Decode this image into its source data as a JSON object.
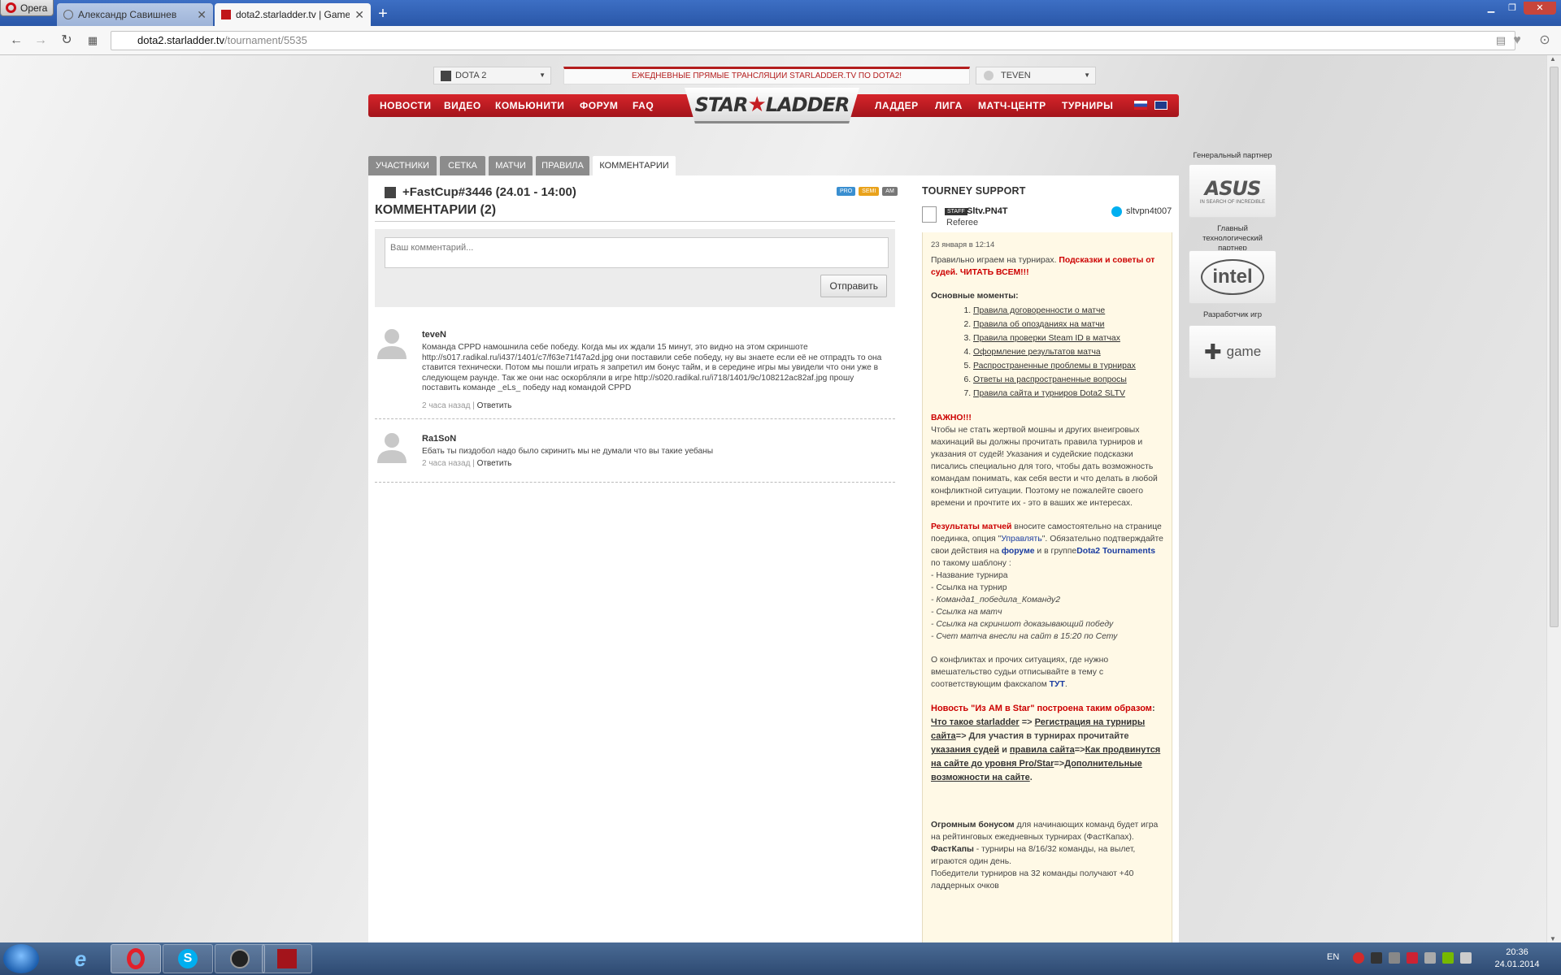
{
  "browser": {
    "menu_label": "Opera",
    "tabs": [
      {
        "label": "Александр Савишнев",
        "active": false
      },
      {
        "label": "dota2.starladder.tv | Game",
        "active": true
      }
    ],
    "new_tab": "+",
    "url_host": "dota2.starladder.tv",
    "url_path": "/tournament/5535"
  },
  "topbar": {
    "game_select": "DOTA 2",
    "promo": "ЕЖЕДНЕВНЫЕ ПРЯМЫЕ ТРАНСЛЯЦИИ STARLADDER.TV ПО DOTA2!",
    "user_select": "TEVEN"
  },
  "nav": {
    "left": [
      "НОВОСТИ",
      "ВИДЕО",
      "КОМЬЮНИТИ",
      "ФОРУМ",
      "FAQ"
    ],
    "logo_left": "STAR",
    "logo_right": "LADDER",
    "right": [
      "ЛАДДЕР",
      "ЛИГА",
      "МАТЧ-ЦЕНТР",
      "ТУРНИРЫ"
    ]
  },
  "page_tabs": [
    "УЧАСТНИКИ",
    "СЕТКА",
    "МАТЧИ",
    "ПРАВИЛА",
    "КОММЕНТАРИИ"
  ],
  "tournament": {
    "title": "+FastCup#3446 (24.01 - 14:00)",
    "badges": [
      {
        "label": "PRO",
        "color": "#3a8fd0"
      },
      {
        "label": "SEMI",
        "color": "#e9a21b"
      },
      {
        "label": "AM",
        "color": "#777777"
      }
    ]
  },
  "comments": {
    "heading": "КОММЕНТАРИИ (2)",
    "placeholder": "Ваш комментарий...",
    "submit": "Отправить",
    "reply_label": "Ответить",
    "items": [
      {
        "author": "teveN",
        "text": "Команда CPPD намошнила себе победу. Когда мы их ждали 15 минут, это видно на этом скриншоте http://s017.radikal.ru/i437/1401/c7/f63e71f47a2d.jpg они поставили себе победу, ну вы знаете если её не отпрадть то она ставится технически. Потом мы пошли играть я запретил им бонус тайм, и в середине игры мы увидели что они уже в следующем раунде. Так же они нас оскорбляли в игре http://s020.radikal.ru/i718/1401/9c/108212ac82af.jpg прошу поставить команде _eLs_ победу над командой CPPD",
        "time": "2 часа назад"
      },
      {
        "author": "Ra1SoN",
        "text": "Ебать ты пиздобол надо было скринить мы не думали что вы такие уебаны",
        "time": "2 часа назад"
      }
    ]
  },
  "support": {
    "title": "TOURNEY SUPPORT",
    "staff_tag": "STAFF",
    "referee_name": "Sltv.PN4T",
    "referee_role": "Referee",
    "skype": "sltvpn4t007",
    "date": "23 января в 12:14",
    "intro": "Правильно играем на турнирах.",
    "intro_red": "Подсказки и советы от судей. ЧИТАТЬ ВСЕМ!!!",
    "points_heading": "Основные моменты:",
    "points": [
      "Правила договоренности о матче",
      "Правила об опозданиях на матчи",
      "Правила проверки Steam ID в матчах",
      "Оформление результатов матча",
      "Распространенные проблемы в турнирах",
      "Ответы на распространенные вопросы",
      "Правила сайта и турниров Dota2 SLTV"
    ],
    "important_heading": "ВАЖНО!!!",
    "important_text": "Чтобы не стать жертвой мошны и других внеигровых махинаций вы должны прочитать правила турниров и указания от судей! Указания и судейские подсказки писались специально для того, чтобы дать возможность командам понимать, как себя вести и что делать в любой конфликтной ситуации. Поэтому не пожалейте своего времени и прочтите их - это в ваших же интересах.",
    "results_red": "Результаты матчей",
    "results_1": " вносите самостоятельно на странице поединка, опция \"",
    "results_manage": "Управлять",
    "results_2": "\". Обязательно подтверждайте свои действия на ",
    "results_forum": "форуме",
    "results_3": " и в группе",
    "results_group": "Dota2 Tournaments",
    "results_4": " по такому шаблону :",
    "template_lines": [
      "- Название турнира",
      "- Ссылка на турнир",
      "- Команда1_победила_Команду2",
      "- Ссылка на матч",
      "- Ссылка на скриншот доказывающий победу",
      "- Счет матча внесли на сайт в 15:20 по Сету"
    ],
    "conflicts_1": "О конфликтах и прочих ситуациях, где нужно вмешательство судьи отписывайте в тему с соответствующим факскапом ",
    "conflicts_link": "ТУТ",
    "conflicts_2": ".",
    "news_red": "Новость \"Из АМ в Star\" построена таким образом",
    "news_links": [
      "Что такое starladder",
      "Регистрация на турниры сайта",
      "указания судей",
      "правила сайта",
      "Как продвинутся на сайте до уровня Pro/Star",
      "Дополнительные возможности на сайте"
    ],
    "news_mid": "=> Для участия в турнирах прочитайте ",
    "bonus_bold": "Огромным бонусом",
    "bonus_text": " для начинающих команд будет игра на рейтинговых ежедневных турнирах (ФастКапах).",
    "fastcup_bold": "ФастКапы",
    "fastcup_text": " - турниры на 8/16/32 команды, на вылет, играются один день.",
    "winners_text": "Победители турниров на 32 команды получают +40 ладдерных очков"
  },
  "sponsors": [
    {
      "label": "Генеральный партнер",
      "name": "ASUS",
      "tagline": "IN SEARCH OF INCREDIBLE"
    },
    {
      "label": "Главный технологический партнер",
      "name": "intel"
    },
    {
      "label": "Разработчик игр",
      "name": "game"
    }
  ],
  "taskbar": {
    "lang": "EN",
    "time": "20:36",
    "date": "24.01.2014"
  }
}
